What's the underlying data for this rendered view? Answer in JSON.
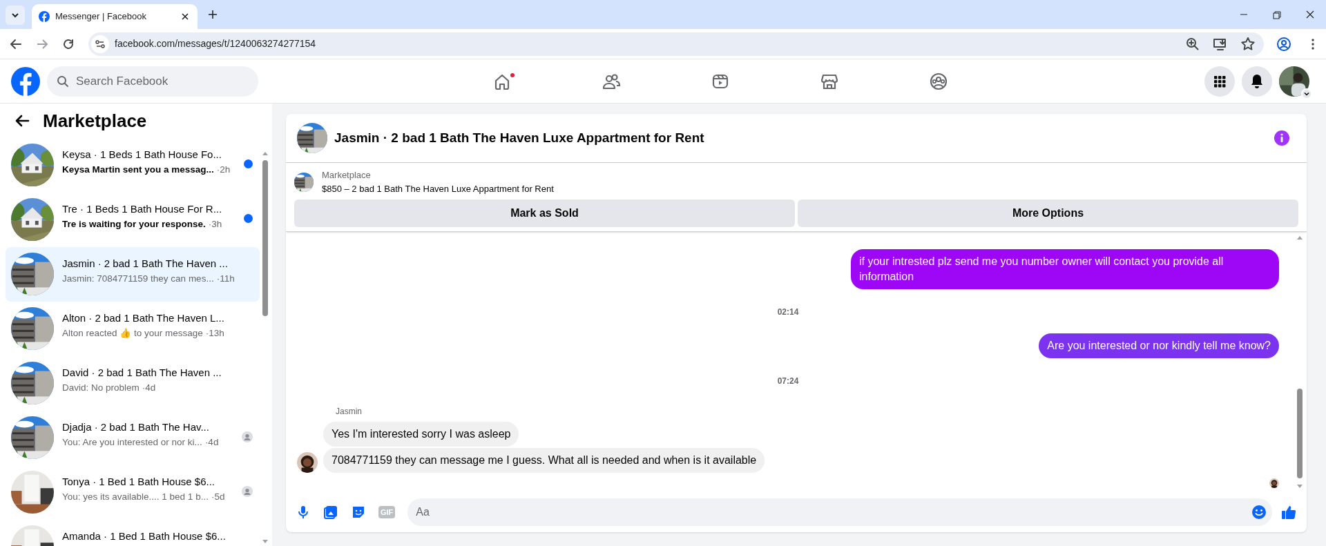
{
  "browser": {
    "tab_title": "Messenger | Facebook",
    "url": "facebook.com/messages/t/1240063274277154"
  },
  "header": {
    "search_placeholder": "Search Facebook",
    "nav": [
      {
        "kind": "home",
        "badge": true
      },
      {
        "kind": "friends",
        "badge": false
      },
      {
        "kind": "video",
        "badge": false
      },
      {
        "kind": "marketplace",
        "badge": false
      },
      {
        "kind": "groups",
        "badge": false
      }
    ]
  },
  "sidebar": {
    "title": "Marketplace",
    "conversations": [
      {
        "title": "Keysa · 1 Beds 1 Bath House Fo...",
        "preview": "Keysa Martin sent you a messag...",
        "time": "·2h",
        "unread": true,
        "selected": false,
        "seen": false
      },
      {
        "title": "Tre · 1 Beds 1 Bath House For R...",
        "preview": "Tre is waiting for your response.",
        "time": "·3h",
        "unread": true,
        "selected": false,
        "seen": false
      },
      {
        "title": "Jasmin · 2 bad 1 Bath The Haven ...",
        "preview": "Jasmin: 7084771159 they can mes...",
        "time": "·11h",
        "unread": false,
        "selected": true,
        "seen": false
      },
      {
        "title": "Alton · 2 bad 1 Bath The Haven L...",
        "preview": "Alton reacted 👍 to your message",
        "time": "·13h",
        "unread": false,
        "selected": false,
        "seen": false
      },
      {
        "title": "David · 2 bad 1 Bath The Haven ...",
        "preview": "David: No problem",
        "time": "·4d",
        "unread": false,
        "selected": false,
        "seen": false
      },
      {
        "title": "Djadja · 2 bad 1 Bath The Hav...",
        "preview": "You: Are you interested or nor ki...",
        "time": "·4d",
        "unread": false,
        "selected": false,
        "seen": true
      },
      {
        "title": "Tonya · 1 Bed 1 Bath House $6...",
        "preview": "You: yes its available.... 1 bed 1 b...",
        "time": "·5d",
        "unread": false,
        "selected": false,
        "seen": true
      },
      {
        "title": "Amanda · 1 Bed 1 Bath House $6...",
        "selected": false
      }
    ]
  },
  "chat": {
    "title": "Jasmin · 2 bad 1 Bath The Haven Luxe Appartment for Rent",
    "listing_label": "Marketplace",
    "listing": "$850 – 2 bad 1 Bath The Haven Luxe Appartment for Rent",
    "buttons": [
      "Mark as Sold",
      "More Options"
    ],
    "messages": [
      {
        "kind": "outgoing",
        "text": "if your intrested plz send me you number owner will contact you provide all information",
        "color": "#9e06f6"
      },
      {
        "kind": "time",
        "text": "02:14"
      },
      {
        "kind": "outgoing",
        "text": "Are you interested or nor kindly tell me know?",
        "color": "#7b33f0"
      },
      {
        "kind": "time",
        "text": "07:24"
      },
      {
        "kind": "sender",
        "text": "Jasmin"
      },
      {
        "kind": "incoming",
        "text": "Yes I'm interested sorry I was asleep",
        "avatar": false
      },
      {
        "kind": "incoming",
        "text": "7084771159 they can message me I guess. What all is needed and when is it available",
        "avatar": true
      }
    ],
    "composer": {
      "gif": "GIF",
      "placeholder": "Aa"
    }
  }
}
